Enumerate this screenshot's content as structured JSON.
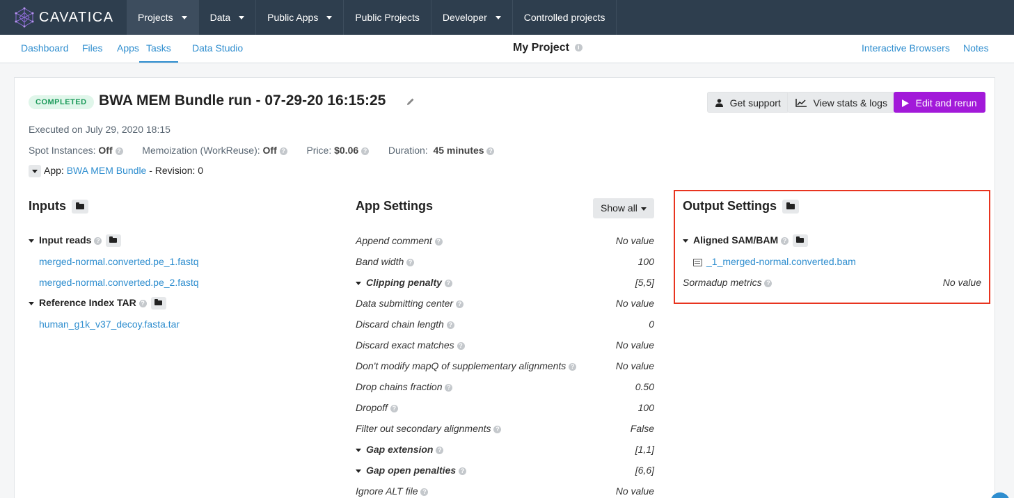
{
  "brand": {
    "name": "CAVATICA"
  },
  "topnav": [
    {
      "label": "Projects",
      "has_caret": true,
      "active": true
    },
    {
      "label": "Data",
      "has_caret": true
    },
    {
      "label": "Public Apps",
      "has_caret": true
    },
    {
      "label": "Public Projects",
      "has_caret": false
    },
    {
      "label": "Developer",
      "has_caret": true
    },
    {
      "label": "Controlled projects",
      "has_caret": false
    }
  ],
  "subnav": {
    "tabs": [
      "Dashboard",
      "Files",
      "Apps",
      "Tasks",
      "Data Studio"
    ],
    "active_tab": "Tasks",
    "project_title": "My Project",
    "right_links": [
      "Interactive Browsers",
      "Notes"
    ]
  },
  "task": {
    "status": "COMPLETED",
    "title": "BWA MEM Bundle run - 07-29-20 16:15:25",
    "executed": "Executed on July 29, 2020 18:15",
    "spot_label": "Spot Instances:",
    "spot_value": "Off",
    "memo_label": "Memoization (WorkReuse):",
    "memo_value": "Off",
    "price_label": "Price:",
    "price_value": "$0.06",
    "duration_label": "Duration:",
    "duration_value": "45 minutes",
    "app_label": "App:",
    "app_name": "BWA MEM Bundle",
    "revision": "- Revision: 0"
  },
  "actions": {
    "support": "Get support",
    "stats": "View stats & logs",
    "rerun": "Edit and rerun"
  },
  "inputs": {
    "title": "Inputs",
    "groups": [
      {
        "label": "Input reads",
        "files": [
          "merged-normal.converted.pe_1.fastq",
          "merged-normal.converted.pe_2.fastq"
        ]
      },
      {
        "label": "Reference Index TAR",
        "files": [
          "human_g1k_v37_decoy.fasta.tar"
        ]
      }
    ]
  },
  "app_settings": {
    "title": "App Settings",
    "show_all": "Show all",
    "rows": [
      {
        "label": "Append comment",
        "value": "No value",
        "group": false
      },
      {
        "label": "Band width",
        "value": "100",
        "group": false
      },
      {
        "label": "Clipping penalty",
        "value": "[5,5]",
        "group": true
      },
      {
        "label": "Data submitting center",
        "value": "No value",
        "group": false
      },
      {
        "label": "Discard chain length",
        "value": "0",
        "group": false
      },
      {
        "label": "Discard exact matches",
        "value": "No value",
        "group": false
      },
      {
        "label": "Don't modify mapQ of supplementary alignments",
        "value": "No value",
        "group": false
      },
      {
        "label": "Drop chains fraction",
        "value": "0.50",
        "group": false
      },
      {
        "label": "Dropoff",
        "value": "100",
        "group": false
      },
      {
        "label": "Filter out secondary alignments",
        "value": "False",
        "group": false
      },
      {
        "label": "Gap extension",
        "value": "[1,1]",
        "group": true
      },
      {
        "label": "Gap open penalties",
        "value": "[6,6]",
        "group": true
      },
      {
        "label": "Ignore ALT file",
        "value": "No value",
        "group": false
      }
    ]
  },
  "outputs": {
    "title": "Output Settings",
    "group_label": "Aligned SAM/BAM",
    "file": "_1_merged-normal.converted.bam",
    "metric_label": "Sormadup metrics",
    "metric_value": "No value"
  },
  "colors": {
    "nav_bg": "#2e3e4e",
    "link": "#2f8ecf",
    "primary": "#a219d9",
    "completed": "#1c9a5a",
    "highlight": "#e8341f"
  }
}
